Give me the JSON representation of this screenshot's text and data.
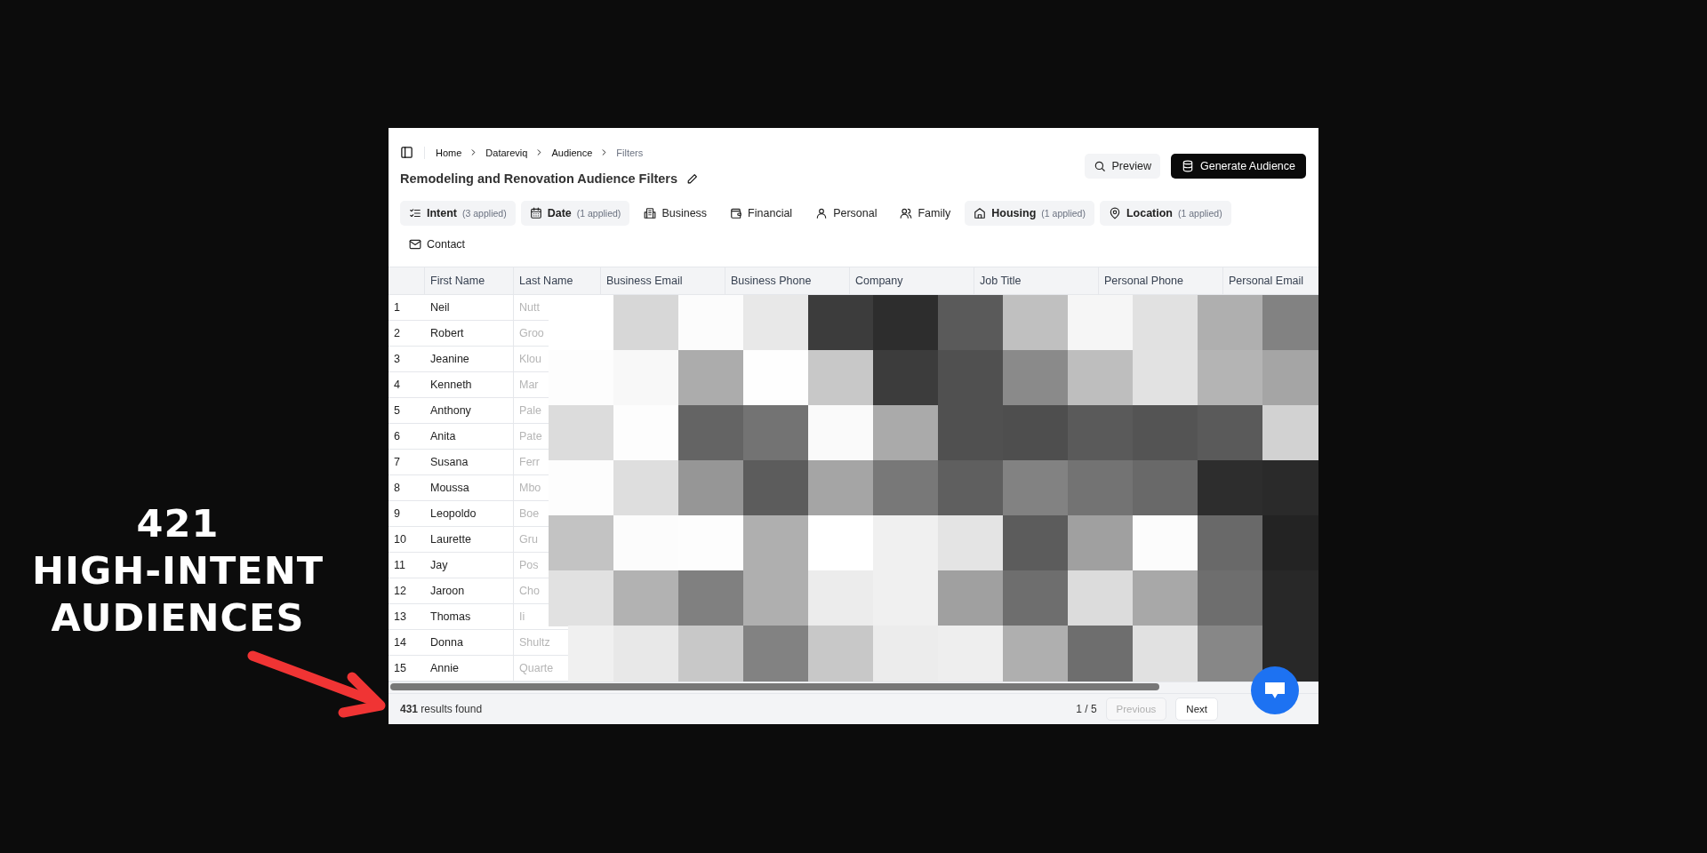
{
  "annotation": {
    "lines": [
      "421",
      "HIGH-INTENT",
      "AUDIENCES"
    ]
  },
  "breadcrumb": [
    {
      "label": "Home",
      "current": false
    },
    {
      "label": "Datareviq",
      "current": false
    },
    {
      "label": "Audience",
      "current": false
    },
    {
      "label": "Filters",
      "current": true
    }
  ],
  "title": "Remodeling and Renovation Audience Filters",
  "actions": [
    {
      "label": "Preview",
      "kind": "secondary"
    },
    {
      "label": "Generate Audience",
      "kind": "primary"
    }
  ],
  "filter_tabs": [
    {
      "label": "Intent",
      "applied": "(3 applied)"
    },
    {
      "label": "Date",
      "applied": "(1 applied)"
    },
    {
      "label": "Business"
    },
    {
      "label": "Financial"
    },
    {
      "label": "Personal"
    },
    {
      "label": "Family"
    },
    {
      "label": "Housing",
      "applied": "(1 applied)"
    },
    {
      "label": "Location",
      "applied": "(1 applied)"
    },
    {
      "label": "Contact"
    }
  ],
  "table": {
    "columns": [
      "First Name",
      "Last Name",
      "Business Email",
      "Business Phone",
      "Company",
      "Job Title",
      "Personal Phone",
      "Personal Email"
    ],
    "rows": [
      {
        "index": "1",
        "first_name": "Neil",
        "last_name": "Nutt"
      },
      {
        "index": "2",
        "first_name": "Robert",
        "last_name": "Groo"
      },
      {
        "index": "3",
        "first_name": "Jeanine",
        "last_name": "Klou"
      },
      {
        "index": "4",
        "first_name": "Kenneth",
        "last_name": "Mar"
      },
      {
        "index": "5",
        "first_name": "Anthony",
        "last_name": "Pale"
      },
      {
        "index": "6",
        "first_name": "Anita",
        "last_name": "Pate"
      },
      {
        "index": "7",
        "first_name": "Susana",
        "last_name": "Ferr"
      },
      {
        "index": "8",
        "first_name": "Moussa",
        "last_name": "Mbo"
      },
      {
        "index": "9",
        "first_name": "Leopoldo",
        "last_name": "Boe"
      },
      {
        "index": "10",
        "first_name": "Laurette",
        "last_name": "Gru"
      },
      {
        "index": "11",
        "first_name": "Jay",
        "last_name": "Pos"
      },
      {
        "index": "12",
        "first_name": "Jaroon",
        "last_name": "Cho"
      },
      {
        "index": "13",
        "first_name": "Thomas",
        "last_name": "Ii"
      },
      {
        "index": "14",
        "first_name": "Donna",
        "last_name": "Shultz"
      },
      {
        "index": "15",
        "first_name": "Annie",
        "last_name": "Quarte"
      }
    ]
  },
  "footer": {
    "results": "**431** results found",
    "page": "1 / 5",
    "buttons": [
      {
        "label": "Previous",
        "disabled": true
      },
      {
        "label": "Next",
        "disabled": false
      }
    ]
  }
}
